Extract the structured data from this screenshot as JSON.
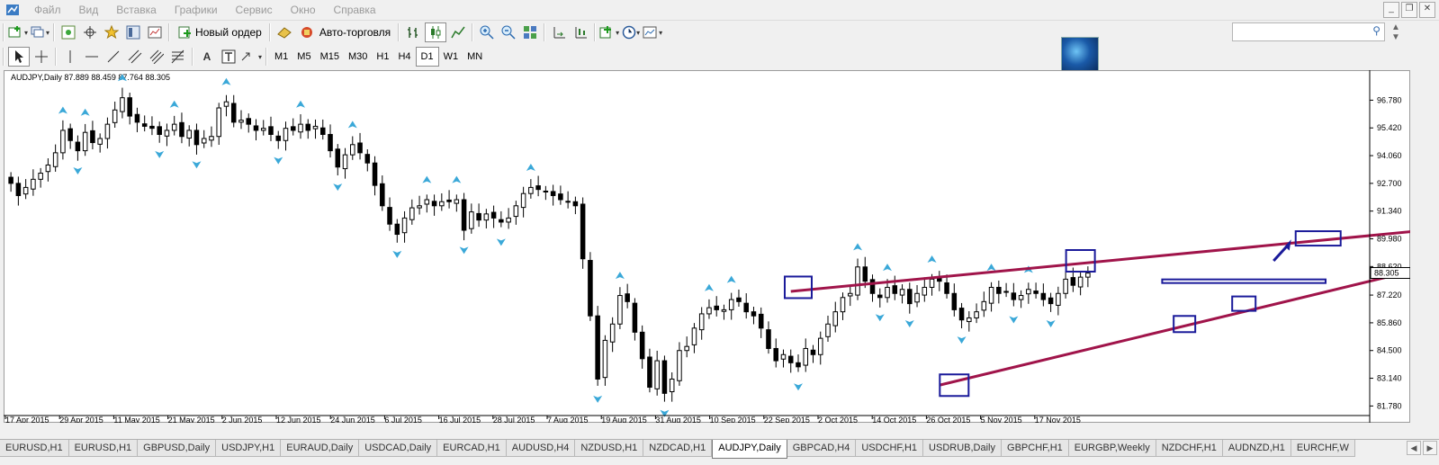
{
  "menu": {
    "items": [
      "Файл",
      "Вид",
      "Вставка",
      "Графики",
      "Сервис",
      "Окно",
      "Справка"
    ]
  },
  "window_controls": [
    "minimize-icon",
    "restore-icon",
    "close-icon"
  ],
  "toolbar1": {
    "new_order_label": "Новый ордер",
    "auto_trading_label": "Авто-торговля"
  },
  "toolbar2": {
    "text_tool_label": "A",
    "timeframes": [
      "M1",
      "M5",
      "M15",
      "M30",
      "H1",
      "H4",
      "D1",
      "W1",
      "MN"
    ],
    "active_timeframe": "D1"
  },
  "search": {
    "placeholder": ""
  },
  "chart_data": {
    "type": "candlestick",
    "symbol_info": "AUDJPY,Daily  87.889 88.459 87.764 88.305",
    "current_price_label": "88.305",
    "y_ticks": [
      "96.780",
      "95.420",
      "94.060",
      "92.700",
      "91.340",
      "89.980",
      "88.620",
      "87.220",
      "85.860",
      "84.500",
      "83.140",
      "81.780"
    ],
    "y_tick_values": [
      96.78,
      95.42,
      94.06,
      92.7,
      91.34,
      89.98,
      88.62,
      87.22,
      85.86,
      84.5,
      83.14,
      81.78
    ],
    "x_ticks": [
      "17 Apr 2015",
      "29 Apr 2015",
      "11 May 2015",
      "21 May 2015",
      "2 Jun 2015",
      "12 Jun 2015",
      "24 Jun 2015",
      "6 Jul 2015",
      "16 Jul 2015",
      "28 Jul 2015",
      "7 Aug 2015",
      "19 Aug 2015",
      "31 Aug 2015",
      "10 Sep 2015",
      "22 Sep 2015",
      "2 Oct 2015",
      "14 Oct 2015",
      "26 Oct 2015",
      "5 Nov 2015",
      "17 Nov 2015"
    ],
    "ylim": [
      81.4,
      97.9
    ],
    "closes": [
      92.7,
      92.1,
      92.5,
      92.9,
      93.2,
      93.6,
      94.2,
      95.3,
      94.8,
      94.3,
      95.2,
      94.7,
      94.9,
      95.6,
      96.3,
      96.9,
      96.0,
      95.7,
      95.5,
      95.4,
      95.1,
      95.3,
      95.6,
      95.0,
      95.3,
      94.6,
      94.9,
      95.0,
      96.4,
      96.7,
      95.7,
      95.8,
      95.6,
      95.3,
      95.4,
      95.1,
      94.8,
      95.4,
      95.3,
      95.6,
      95.3,
      95.5,
      95.1,
      94.3,
      93.5,
      94.1,
      94.6,
      94.2,
      93.7,
      92.6,
      91.6,
      90.7,
      90.2,
      91.0,
      91.5,
      91.6,
      91.9,
      91.6,
      91.8,
      91.8,
      91.9,
      90.4,
      91.3,
      90.9,
      91.2,
      91.0,
      90.8,
      91.0,
      91.6,
      92.2,
      92.5,
      92.4,
      92.3,
      92.1,
      91.9,
      91.8,
      91.6,
      89.0,
      86.2,
      83.1,
      85.0,
      85.8,
      87.2,
      86.9,
      85.4,
      84.1,
      82.7,
      84.0,
      82.4,
      83.1,
      84.5,
      84.7,
      85.6,
      86.3,
      86.6,
      86.5,
      86.5,
      87.0,
      86.9,
      86.4,
      86.2,
      85.6,
      84.6,
      84.0,
      84.3,
      83.9,
      83.7,
      84.6,
      84.3,
      85.1,
      85.8,
      86.4,
      87.1,
      87.3,
      88.6,
      87.9,
      87.3,
      87.1,
      87.6,
      87.3,
      87.5,
      86.8,
      87.3,
      87.6,
      88.0,
      87.9,
      87.3,
      86.5,
      86.0,
      86.1,
      86.4,
      86.9,
      87.6,
      87.3,
      87.4,
      87.0,
      87.2,
      87.5,
      87.3,
      87.0,
      86.8,
      87.3,
      88.0,
      87.7,
      88.1,
      88.3
    ],
    "trend_lines": [
      {
        "name": "upper",
        "from_index": 105,
        "from_price": 87.4,
        "to_index": 199,
        "to_price": 90.7
      },
      {
        "name": "lower",
        "from_index": 125,
        "from_price": 82.8,
        "to_index": 200,
        "to_price": 89.4
      }
    ],
    "colors": {
      "trend": "#a0144a",
      "marker": "#1a1a9a",
      "arrow": "#3aa8d8",
      "bull": "#ffffff",
      "bear": "#000000"
    }
  },
  "tabs": {
    "items": [
      "EURUSD,H1",
      "EURUSD,H1",
      "GBPUSD,Daily",
      "USDJPY,H1",
      "EURAUD,Daily",
      "USDCAD,Daily",
      "EURCAD,H1",
      "AUDUSD,H4",
      "NZDUSD,H1",
      "NZDCAD,H1",
      "AUDJPY,Daily",
      "GBPCAD,H4",
      "USDCHF,H1",
      "USDRUB,Daily",
      "GBPCHF,H1",
      "EURGBP,Weekly",
      "NZDCHF,H1",
      "AUDNZD,H1",
      "EURCHF,W"
    ],
    "active": "AUDJPY,Daily"
  }
}
